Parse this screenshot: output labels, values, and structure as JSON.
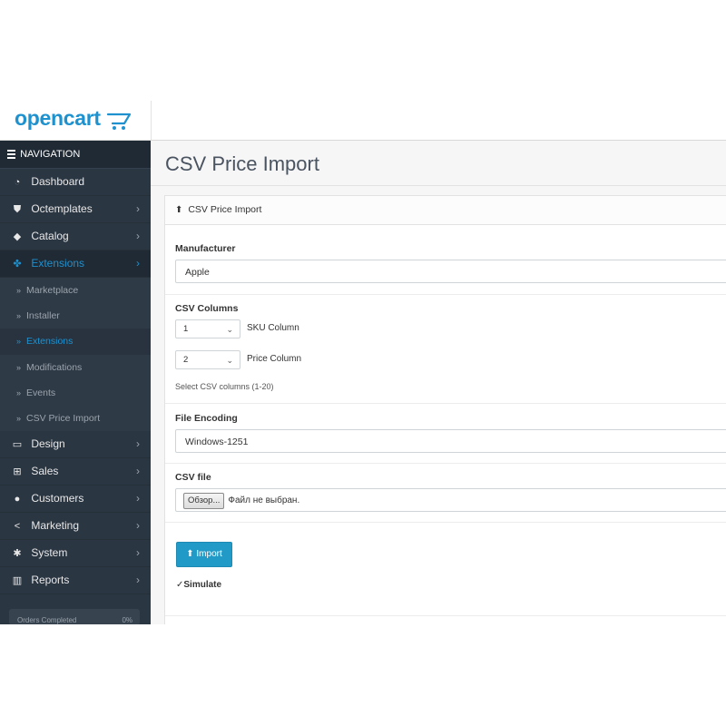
{
  "brand": {
    "logo_text": "opencart",
    "color": "#1e91cf"
  },
  "sidebar": {
    "header": "NAVIGATION",
    "items": [
      {
        "label": "Dashboard",
        "icon": "dashboard-icon",
        "chevron": ""
      },
      {
        "label": "Octemplates",
        "icon": "shield-icon",
        "chevron": "›"
      },
      {
        "label": "Catalog",
        "icon": "tag-icon",
        "chevron": "›"
      },
      {
        "label": "Extensions",
        "icon": "puzzle-icon",
        "chevron": "›",
        "active": true
      }
    ],
    "subitems": [
      {
        "label": "Marketplace"
      },
      {
        "label": "Installer"
      },
      {
        "label": "Extensions",
        "active": true
      },
      {
        "label": "Modifications"
      },
      {
        "label": "Events"
      },
      {
        "label": "CSV Price Import"
      }
    ],
    "items2": [
      {
        "label": "Design",
        "icon": "desktop-icon",
        "chevron": "›"
      },
      {
        "label": "Sales",
        "icon": "cart-icon",
        "chevron": "›"
      },
      {
        "label": "Customers",
        "icon": "user-icon",
        "chevron": "›"
      },
      {
        "label": "Marketing",
        "icon": "share-icon",
        "chevron": "›"
      },
      {
        "label": "System",
        "icon": "gear-icon",
        "chevron": "›"
      },
      {
        "label": "Reports",
        "icon": "bar-chart-icon",
        "chevron": "›"
      }
    ],
    "progress": {
      "label": "Orders Completed",
      "value": "0%"
    }
  },
  "page": {
    "title": "CSV Price Import",
    "panel_title": "CSV Price Import",
    "manufacturer": {
      "label": "Manufacturer",
      "value": "Apple"
    },
    "csv_columns": {
      "label": "CSV Columns",
      "sku": {
        "value": "1",
        "label": "SKU Column"
      },
      "price": {
        "value": "2",
        "label": "Price Column"
      },
      "help": "Select CSV columns (1-20)"
    },
    "encoding": {
      "label": "File Encoding",
      "value": "Windows-1251"
    },
    "csv_file": {
      "label": "CSV file",
      "button": "Обзор...",
      "status": "Файл не выбран."
    },
    "import_button": "Import",
    "simulate": {
      "label": "Simulate",
      "checked": true
    }
  }
}
